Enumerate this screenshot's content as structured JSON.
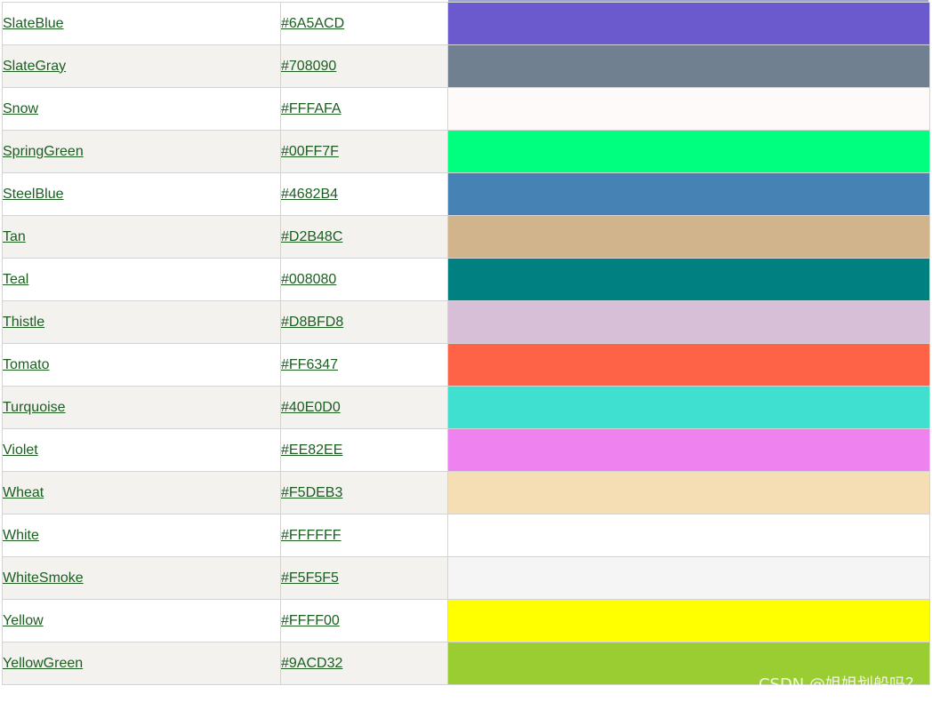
{
  "colors": [
    {
      "name": "SlateBlue",
      "hex": "#6A5ACD",
      "swatch": "#6A5ACD"
    },
    {
      "name": "SlateGray",
      "hex": "#708090",
      "swatch": "#708090"
    },
    {
      "name": "Snow",
      "hex": "#FFFAFA",
      "swatch": "#FFFAFA"
    },
    {
      "name": "SpringGreen",
      "hex": "#00FF7F",
      "swatch": "#00FF7F"
    },
    {
      "name": "SteelBlue",
      "hex": "#4682B4",
      "swatch": "#4682B4"
    },
    {
      "name": "Tan",
      "hex": "#D2B48C",
      "swatch": "#D2B48C"
    },
    {
      "name": "Teal",
      "hex": "#008080",
      "swatch": "#008080"
    },
    {
      "name": "Thistle",
      "hex": "#D8BFD8",
      "swatch": "#D8BFD8"
    },
    {
      "name": "Tomato",
      "hex": "#FF6347",
      "swatch": "#FF6347"
    },
    {
      "name": "Turquoise",
      "hex": "#40E0D0",
      "swatch": "#40E0D0"
    },
    {
      "name": "Violet",
      "hex": "#EE82EE",
      "swatch": "#EE82EE"
    },
    {
      "name": "Wheat",
      "hex": "#F5DEB3",
      "swatch": "#F5DEB3"
    },
    {
      "name": "White",
      "hex": "#FFFFFF",
      "swatch": "#FFFFFF"
    },
    {
      "name": "WhiteSmoke",
      "hex": "#F5F5F5",
      "swatch": "#F5F5F5"
    },
    {
      "name": "Yellow",
      "hex": "#FFFF00",
      "swatch": "#FFFF00"
    },
    {
      "name": "YellowGreen",
      "hex": "#9ACD32",
      "swatch": "#9ACD32"
    }
  ],
  "watermark": "CSDN @姐姐划船吗？",
  "theme": {
    "link_color": "#1B5E20",
    "row_alt_bg": "#F3F2EE",
    "border_color": "#D4D4D4"
  }
}
